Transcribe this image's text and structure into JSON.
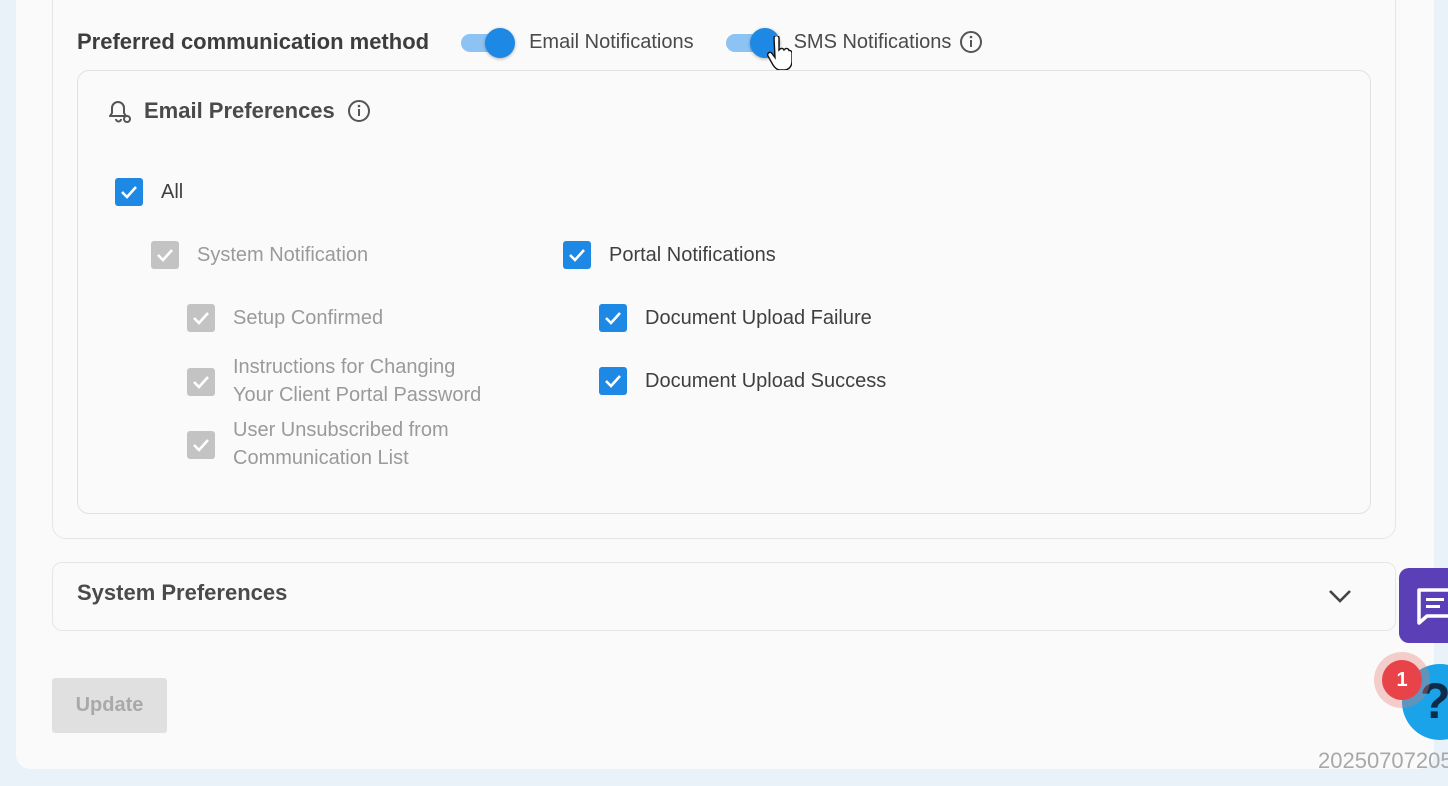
{
  "preferred": {
    "title": "Preferred communication method",
    "email_toggle": {
      "label": "Email Notifications",
      "on": true
    },
    "sms_toggle": {
      "label": "SMS Notifications",
      "on": true
    }
  },
  "email_preferences": {
    "title": "Email Preferences",
    "all": {
      "label": "All",
      "checked": true
    },
    "system_notification": {
      "label": "System Notification",
      "checked": true,
      "disabled": true,
      "items": [
        {
          "label_line1": "Setup Confirmed",
          "label_line2": ""
        },
        {
          "label_line1": "Instructions for Changing",
          "label_line2": "Your Client Portal Password"
        },
        {
          "label_line1": "User Unsubscribed from",
          "label_line2": "Communication List"
        }
      ]
    },
    "portal_notifications": {
      "label": "Portal Notifications",
      "checked": true,
      "items": [
        {
          "label": "Document Upload Failure",
          "checked": true
        },
        {
          "label": "Document Upload Success",
          "checked": true
        }
      ]
    }
  },
  "system_preferences": {
    "title": "System Preferences"
  },
  "update_button": {
    "label": "Update",
    "disabled": true
  },
  "help_badge": {
    "count": "1",
    "glyph": "?"
  },
  "watermark": "20250707205",
  "colors": {
    "accent": "#1e88e5",
    "disabled_check": "#c3c3c3",
    "chat": "#5b3fb6",
    "badge": "#e9434a"
  }
}
